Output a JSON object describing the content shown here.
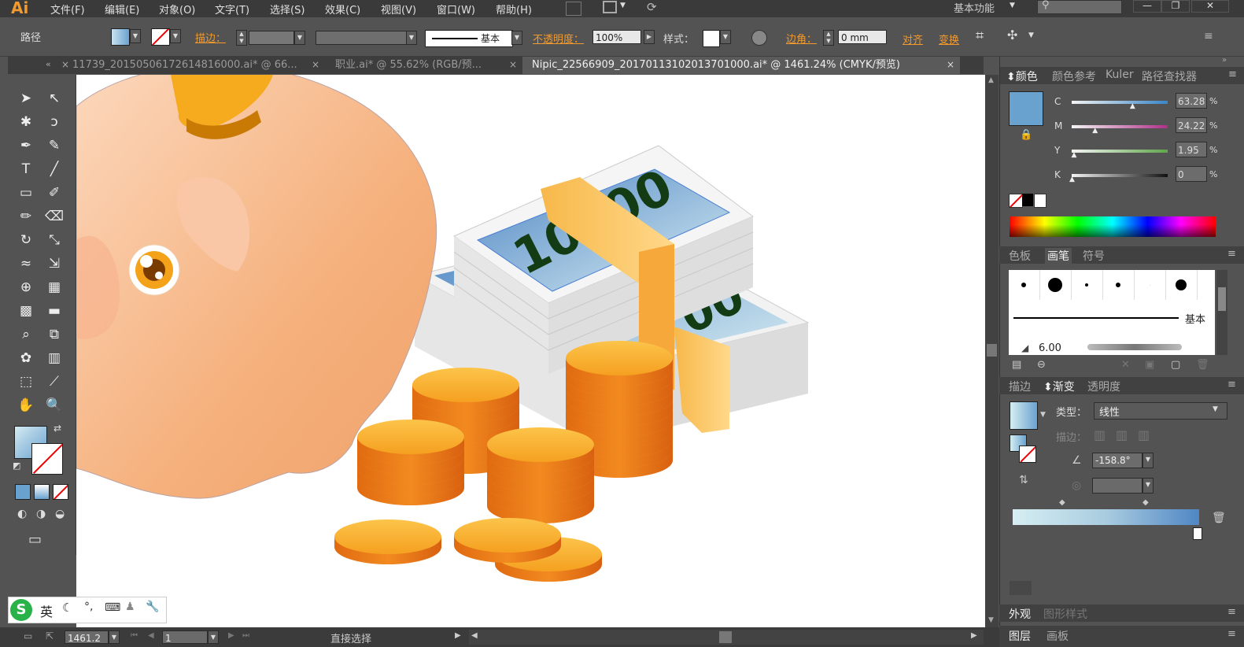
{
  "app": {
    "logo": "Ai",
    "workspace": "基本功能",
    "search_placeholder": ""
  },
  "menu": [
    "文件(F)",
    "编辑(E)",
    "对象(O)",
    "文字(T)",
    "选择(S)",
    "效果(C)",
    "视图(V)",
    "窗口(W)",
    "帮助(H)"
  ],
  "control_bar": {
    "object_type": "路径",
    "stroke_label": "描边：",
    "stroke_style": "基本",
    "opacity_label": "不透明度：",
    "opacity_value": "100%",
    "style_label": "样式：",
    "corner_label": "边角：",
    "corner_value": "0 mm",
    "align_label": "对齐",
    "transform_label": "变换"
  },
  "tabs": [
    {
      "label": "11739_20150506172614816000.ai* @ 66...",
      "active": false
    },
    {
      "label": "职业.ai* @ 55.62% (RGB/预...",
      "active": false
    },
    {
      "label": "Nipic_22566909_20170113102013701000.ai* @ 1461.24% (CMYK/预览)",
      "active": true
    }
  ],
  "tools": [
    "selection-arrow",
    "direct-selection",
    "magic-wand",
    "lasso",
    "pen",
    "curvature",
    "type",
    "line-segment",
    "rectangle",
    "paintbrush",
    "pencil",
    "eraser",
    "rotate",
    "scale",
    "warp",
    "free-transform",
    "shape-builder",
    "perspective-grid",
    "mesh",
    "gradient",
    "eyedropper",
    "blend",
    "symbol-sprayer",
    "column-graph",
    "artboard",
    "slice",
    "hand",
    "zoom"
  ],
  "canvas_text": {
    "note_big": "10000",
    "note_back": "00"
  },
  "color_panel": {
    "tabs": [
      "颜色",
      "颜色参考",
      "Kuler",
      "路径查找器"
    ],
    "channels": [
      {
        "label": "C",
        "value": "63.28",
        "fraction": 0.63,
        "color": "#3a86c8"
      },
      {
        "label": "M",
        "value": "24.22",
        "fraction": 0.24,
        "color": "#b0308a"
      },
      {
        "label": "Y",
        "value": "1.95",
        "fraction": 0.02,
        "color": "#5fa64a"
      },
      {
        "label": "K",
        "value": "0",
        "fraction": 0,
        "color": "#111111"
      }
    ],
    "swatch_color": "#6aa2cf"
  },
  "brush_panel": {
    "tabs": [
      "色板",
      "画笔",
      "符号"
    ],
    "basic_label": "基本",
    "size_value": "6.00"
  },
  "gradient_panel": {
    "tabs": [
      "描边",
      "渐变",
      "透明度"
    ],
    "type_label": "类型：",
    "type_value": "线性",
    "stroke_label": "描边：",
    "angle_value": "-158.8°"
  },
  "bottom_panels": {
    "appearance": "外观",
    "graphic_styles": "图形样式",
    "layers": "图层",
    "artboards": "画板"
  },
  "status": {
    "zoom": "1461.2",
    "page": "1",
    "tool_label": "直接选择"
  },
  "ime": {
    "lang": "英"
  }
}
